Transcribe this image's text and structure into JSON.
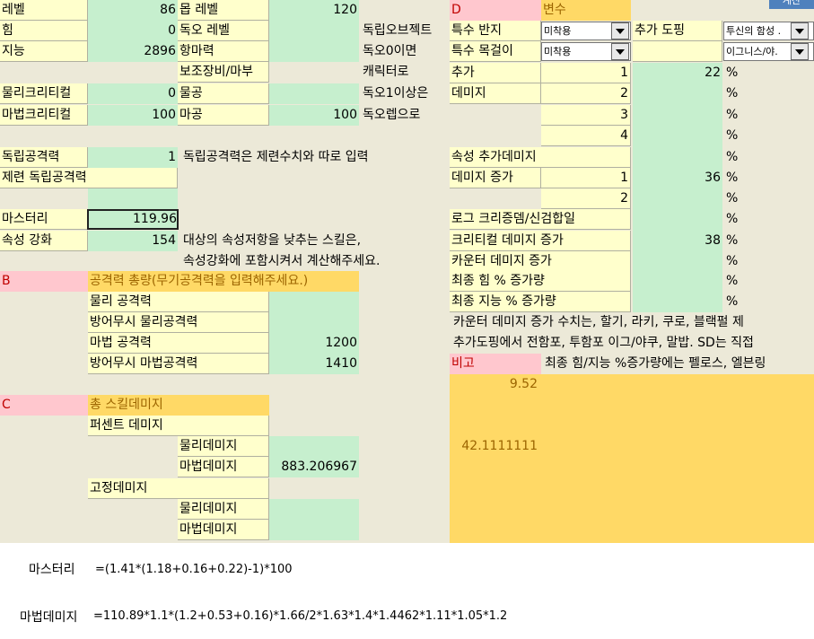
{
  "cells": {
    "level_label": "레벨",
    "level_value": "86",
    "dock_level_label": "몹 레벨",
    "dock_level_value": "120",
    "str_label": "힘",
    "str_value": "0",
    "poison_level_label": "독오 레벨",
    "int_label": "지능",
    "int_value": "2896",
    "resist_label": "항마력",
    "sub_label": "보조장비/마부",
    "phys_crit_label": "물리크리티컬",
    "phys_crit_value": "0",
    "phys_atk_label": "물공",
    "mag_crit_label": "마법크리티컬",
    "mag_crit_value": "100",
    "mag_atk_label": "마공",
    "mag_atk_value": "100",
    "note_indep1": "독립오브젝트",
    "note_indep2": "독오0이면",
    "note_indep3": "캐릭터로",
    "note_indep4": "독오1이상은",
    "note_indep5": "독오렙으로",
    "indep_atk_label": "독립공격력",
    "indep_atk_value": "1",
    "indep_atk_note": "독립공격력은 제련수치와 따로 입력",
    "refine_indep_label": "제련 독립공격력",
    "mastery_label": "마스터리",
    "mastery_value": "119.96",
    "elem_label": "속성 강화",
    "elem_value": "154",
    "elem_note1": "대상의 속성저항을 낮추는 스킬은,",
    "elem_note2": "속성강화에 포함시켜서 계산해주세요.",
    "b_tag": "B",
    "b_title": "공격력 총량(무기공격력을 입력해주세요.)",
    "b_phys": "물리 공격력",
    "b_phys_ign": "방어무시 물리공격력",
    "b_mag": "마법 공격력",
    "b_mag_value": "1200",
    "b_mag_ign": "방어무시 마법공격력",
    "b_mag_ign_value": "1410",
    "c_tag": "C",
    "c_title": "총 스킬데미지",
    "c_percent": "퍼센트 데미지",
    "c_phys1": "물리데미지",
    "c_mag1": "마법데미지",
    "c_mag1_value": "883.206967",
    "c_fixed": "고정데미지",
    "c_phys2": "물리데미지",
    "c_mag2": "마법데미지",
    "d_tag": "D",
    "d_title": "변수",
    "special_ring": "특수 반지",
    "special_ring_value": "미착용",
    "special_neck": "특수 목걸이",
    "special_neck_value": "미착용",
    "extra_doping": "추가 도핑",
    "doping1": "투신의 함성 .",
    "doping2": "이그니스/야.",
    "add_label": "추가",
    "dmg_label": "데미지",
    "n1": "1",
    "n2": "2",
    "n3": "3",
    "n4": "4",
    "add_value": "22",
    "elem_add_label": "속성 추가데미지",
    "dmg_inc_label": "데미지 증가",
    "dmg_inc_n1": "1",
    "dmg_inc_value": "36",
    "dmg_inc_n2": "2",
    "log_label": "로그 크리증뎀/신검합일",
    "crit_dmg_label": "크리티컬 데미지 증가",
    "crit_dmg_value": "38",
    "counter_label": "카운터 데미지 증가",
    "final_str_label": "최종 힘 % 증가량",
    "final_int_label": "최종 지능 % 증가량",
    "pct": "%",
    "counter_note": "카운터 데미지 증가 수치는, 할기, 라키, 쿠로, 블랙펄 제",
    "doping_note": "추가도핑에서 전함포, 투함포 이그/야쿠, 말밥. SD는 직접",
    "remarks_label": "비고",
    "remarks_note": "최종 힘/지능 %증가량에는 펠로스, 엘븐링",
    "val_952": "9.52",
    "val_421": "42.1111111",
    "top_btn": "계산"
  },
  "formulas": {
    "mastery_label": "마스터리",
    "mastery_expr": "=(1.41*(1.18+0.16+0.22)-1)*100",
    "magic_label": "마법데미지",
    "magic_expr": "=110.89*1.1*(1.2+0.53+0.16)*1.66/2*1.63*1.4*1.4462*1.11*1.05*1.2"
  }
}
